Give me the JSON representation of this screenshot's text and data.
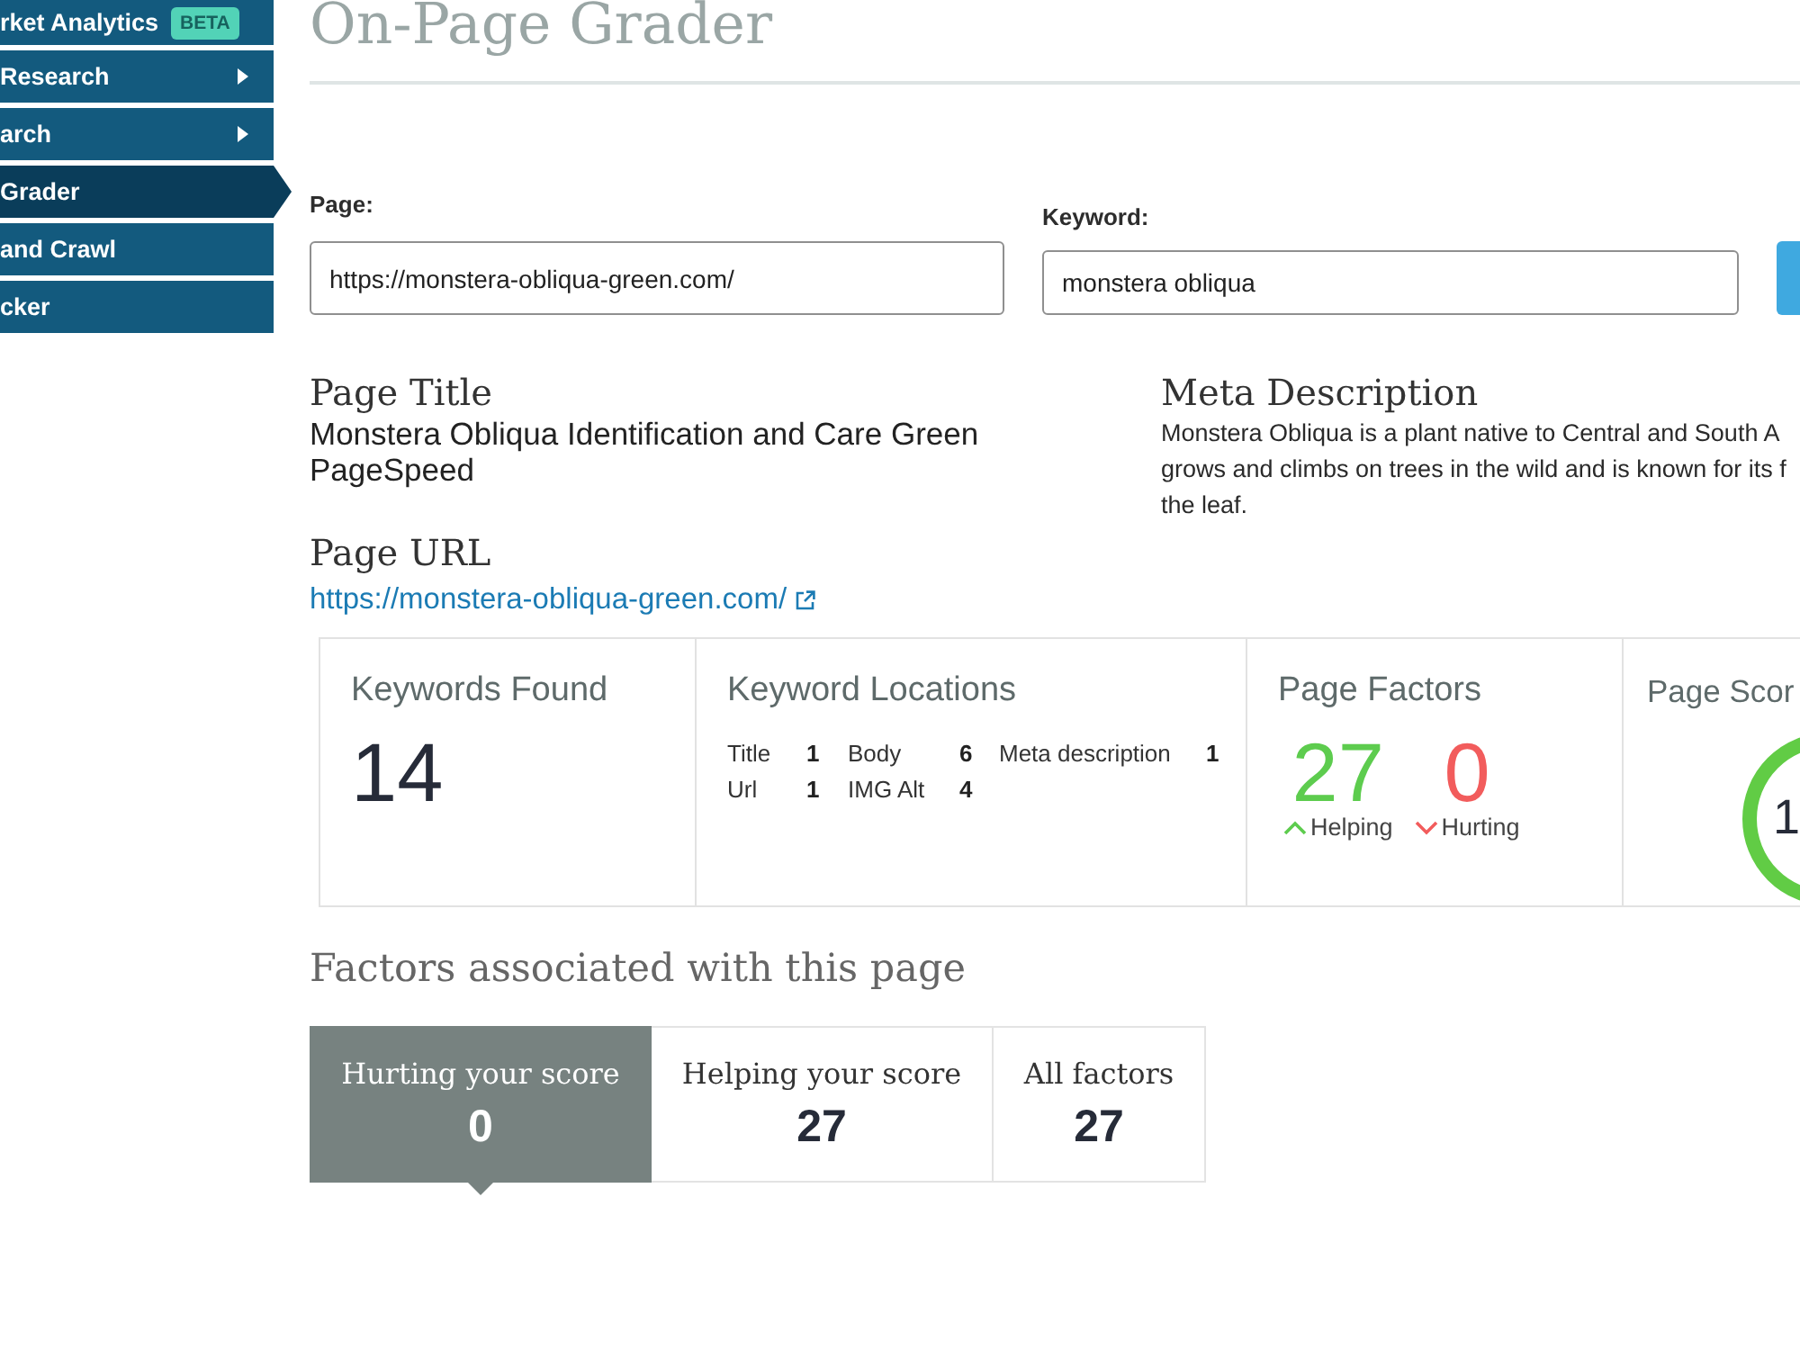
{
  "sidebar": {
    "items": [
      {
        "label": "rket Analytics",
        "badge": "BETA",
        "submenu": false,
        "selected": false
      },
      {
        "label": "Research",
        "submenu": true,
        "selected": false
      },
      {
        "label": "arch",
        "submenu": true,
        "selected": false
      },
      {
        "label": "Grader",
        "submenu": false,
        "selected": true
      },
      {
        "label": "and Crawl",
        "submenu": false,
        "selected": false
      },
      {
        "label": "cker",
        "submenu": false,
        "selected": false
      }
    ]
  },
  "header": {
    "title": "On-Page Grader"
  },
  "form": {
    "page": {
      "label": "Page:",
      "value": "https://monstera-obliqua-green.com/"
    },
    "keyword": {
      "label": "Keyword:",
      "value": "monstera obliqua"
    }
  },
  "page_title": {
    "heading": "Page Title",
    "value": "Monstera Obliqua Identification and Care Green PageSpeed"
  },
  "meta_description": {
    "heading": "Meta Description",
    "lines": [
      "Monstera Obliqua is a plant native to Central and South A",
      "grows and climbs on trees in the wild and is known for its f",
      "the leaf."
    ]
  },
  "page_url": {
    "heading": "Page URL",
    "link": "https://monstera-obliqua-green.com/"
  },
  "stats": {
    "keywords_found": {
      "heading": "Keywords Found",
      "value": "14"
    },
    "keyword_locations": {
      "heading": "Keyword Locations",
      "items": [
        {
          "label": "Title",
          "count": "1"
        },
        {
          "label": "Body",
          "count": "6"
        },
        {
          "label": "Meta description",
          "count": "1"
        },
        {
          "label": "Url",
          "count": "1"
        },
        {
          "label": "IMG Alt",
          "count": "4"
        }
      ]
    },
    "page_factors": {
      "heading": "Page Factors",
      "items": [
        {
          "kind": "helping",
          "value": "27",
          "label": "Helping"
        },
        {
          "kind": "hurting",
          "value": "0",
          "label": "Hurting"
        }
      ]
    },
    "page_score": {
      "heading": "Page Scor",
      "value": "1"
    }
  },
  "factors": {
    "heading": "Factors associated with this page",
    "tabs": [
      {
        "label": "Hurting your score",
        "count": "0",
        "selected": true
      },
      {
        "label": "Helping your score",
        "count": "27",
        "selected": false
      },
      {
        "label": "All factors",
        "count": "27",
        "selected": false
      }
    ]
  }
}
